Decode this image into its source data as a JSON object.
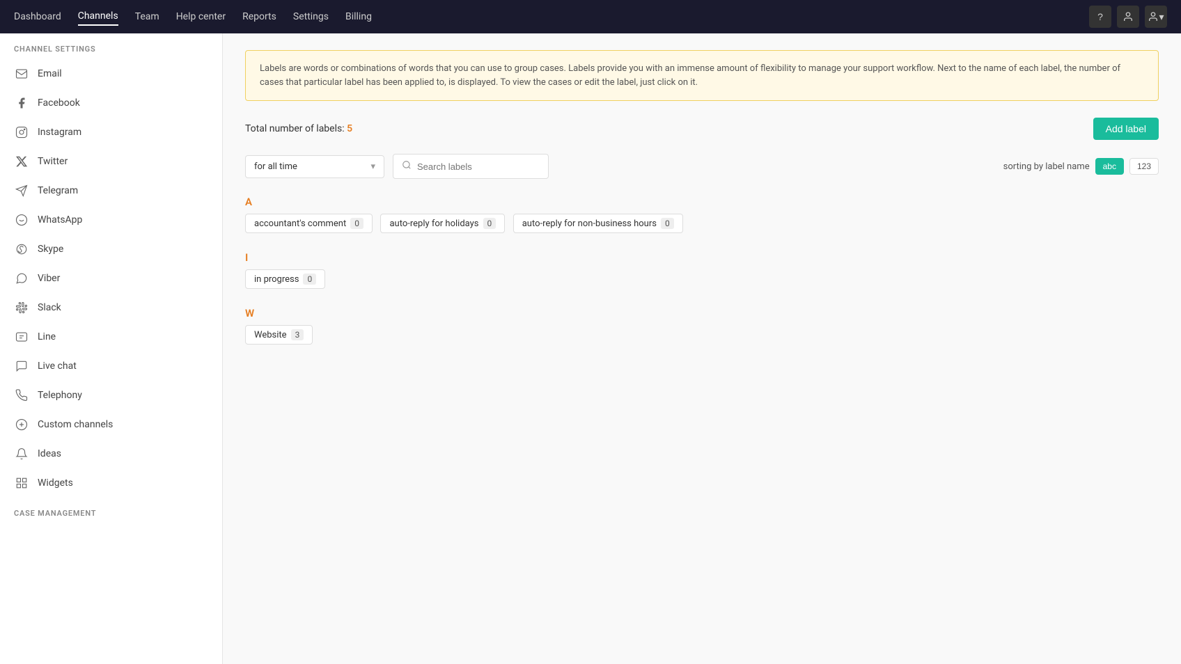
{
  "topnav": {
    "items": [
      {
        "label": "Dashboard",
        "active": false
      },
      {
        "label": "Channels",
        "active": true
      },
      {
        "label": "Team",
        "active": false
      },
      {
        "label": "Help center",
        "active": false
      },
      {
        "label": "Reports",
        "active": false
      },
      {
        "label": "Settings",
        "active": false
      },
      {
        "label": "Billing",
        "active": false
      }
    ],
    "icons": [
      "?",
      "person",
      "profile-arrow"
    ]
  },
  "sidebar": {
    "channel_settings_title": "CHANNEL SETTINGS",
    "channels": [
      {
        "id": "email",
        "icon": "✉",
        "label": "Email"
      },
      {
        "id": "facebook",
        "icon": "f",
        "label": "Facebook"
      },
      {
        "id": "instagram",
        "icon": "◎",
        "label": "Instagram"
      },
      {
        "id": "twitter",
        "icon": "𝕏",
        "label": "Twitter"
      },
      {
        "id": "telegram",
        "icon": "➤",
        "label": "Telegram"
      },
      {
        "id": "whatsapp",
        "icon": "⬤",
        "label": "WhatsApp"
      },
      {
        "id": "skype",
        "icon": "S",
        "label": "Skype"
      },
      {
        "id": "viber",
        "icon": "◉",
        "label": "Viber"
      },
      {
        "id": "slack",
        "icon": "#",
        "label": "Slack"
      },
      {
        "id": "line",
        "icon": "▣",
        "label": "Line"
      },
      {
        "id": "livechat",
        "icon": "💬",
        "label": "Live chat"
      },
      {
        "id": "telephony",
        "icon": "📞",
        "label": "Telephony"
      },
      {
        "id": "custom",
        "icon": "+",
        "label": "Custom channels"
      },
      {
        "id": "ideas",
        "icon": "📢",
        "label": "Ideas"
      },
      {
        "id": "widgets",
        "icon": "⊞",
        "label": "Widgets"
      }
    ],
    "case_management_title": "CASE MANAGEMENT"
  },
  "main": {
    "banner": "Labels are words or combinations of words that you can use to group cases. Labels provide you with an immense amount of flexibility to manage your support workflow. Next to the name of each label, the number of cases that particular label has been applied to, is displayed. To view the cases or edit the label, just click on it.",
    "total_labels_text": "Total number of labels:",
    "total_labels_count": "5",
    "add_label_btn": "Add label",
    "filter_time": "for all time",
    "search_placeholder": "Search labels",
    "sorting_label": "sorting by label name",
    "sort_abc": "abc",
    "sort_123": "123",
    "label_groups": [
      {
        "letter": "A",
        "labels": [
          {
            "name": "accountant's comment",
            "count": "0"
          },
          {
            "name": "auto-reply for holidays",
            "count": "0"
          },
          {
            "name": "auto-reply for non-business hours",
            "count": "0"
          }
        ]
      },
      {
        "letter": "I",
        "labels": [
          {
            "name": "in progress",
            "count": "0"
          }
        ]
      },
      {
        "letter": "W",
        "labels": [
          {
            "name": "Website",
            "count": "3"
          }
        ]
      }
    ]
  }
}
